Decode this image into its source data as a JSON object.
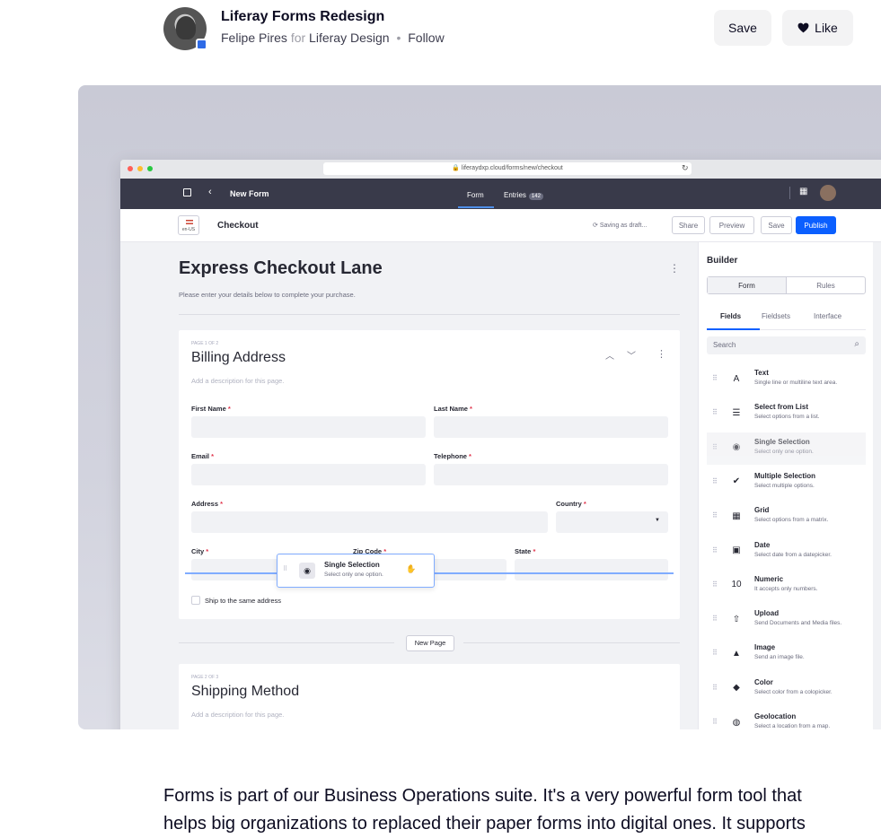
{
  "header": {
    "title": "Liferay Forms Redesign",
    "author": "Felipe Pires",
    "for_word": "for",
    "team": "Liferay Design",
    "separator": "•",
    "follow": "Follow",
    "save_label": "Save",
    "like_label": "Like"
  },
  "app": {
    "url": "liferaydxp.cloud/forms/new/checkout",
    "form_name": "New Form",
    "tabs": [
      {
        "label": "Form"
      },
      {
        "label": "Entries",
        "count": "142"
      }
    ],
    "locale": "en-US",
    "page_heading": "Checkout",
    "saving_status": "Saving as draft...",
    "buttons": {
      "share": "Share",
      "preview": "Preview",
      "save": "Save",
      "publish": "Publish"
    }
  },
  "canvas": {
    "title": "Express Checkout Lane",
    "description": "Please enter your details below to complete your purchase.",
    "page1": {
      "counter": "PAGE 1 OF 2",
      "title": "Billing Address",
      "desc_placeholder": "Add a description for this page.",
      "fields": {
        "first_name": "First Name",
        "last_name": "Last Name",
        "email": "Email",
        "telephone": "Telephone",
        "address": "Address",
        "country": "Country",
        "city": "City",
        "zip": "Zip Code",
        "state": "State"
      },
      "required_mark": "*",
      "checkbox_label": "Ship to the same address"
    },
    "new_page": "New Page",
    "page2": {
      "counter": "PAGE 2 OF 3",
      "title": "Shipping Method",
      "desc_placeholder": "Add a description for this page."
    },
    "drag_card": {
      "name": "Single Selection",
      "desc": "Select only one option."
    }
  },
  "sidebar": {
    "title": "Builder",
    "segments": [
      "Form",
      "Rules"
    ],
    "tabs": [
      "Fields",
      "Fieldsets",
      "Interface"
    ],
    "search_placeholder": "Search",
    "fields": [
      {
        "icon": "text-icon",
        "glyph": "A",
        "name": "Text",
        "desc": "Single line or multiline text area."
      },
      {
        "icon": "list-icon",
        "glyph": "☰",
        "name": "Select from List",
        "desc": "Select options from a list."
      },
      {
        "icon": "radio-icon",
        "glyph": "◉",
        "name": "Single Selection",
        "desc": "Select only one option.",
        "ghost": true
      },
      {
        "icon": "checkbox-icon",
        "glyph": "✔",
        "name": "Multiple Selection",
        "desc": "Select multiple options."
      },
      {
        "icon": "grid-icon",
        "glyph": "▦",
        "name": "Grid",
        "desc": "Select options from a matrix."
      },
      {
        "icon": "calendar-icon",
        "glyph": "▣",
        "name": "Date",
        "desc": "Select date from a datepicker."
      },
      {
        "icon": "numeric-icon",
        "glyph": "10",
        "name": "Numeric",
        "desc": "It accepts only numbers."
      },
      {
        "icon": "upload-icon",
        "glyph": "⇧",
        "name": "Upload",
        "desc": "Send Documents and Media files."
      },
      {
        "icon": "image-icon",
        "glyph": "▲",
        "name": "Image",
        "desc": "Send an image file."
      },
      {
        "icon": "color-icon",
        "glyph": "◆",
        "name": "Color",
        "desc": "Select color from a colopicker."
      },
      {
        "icon": "geolocation-icon",
        "glyph": "◍",
        "name": "Geolocation",
        "desc": "Select a location from a map."
      }
    ]
  },
  "description": "Forms is part of our Business Operations suite. It's a very powerful form tool that helps big organizations to replaced their paper forms into digital ones. It supports"
}
